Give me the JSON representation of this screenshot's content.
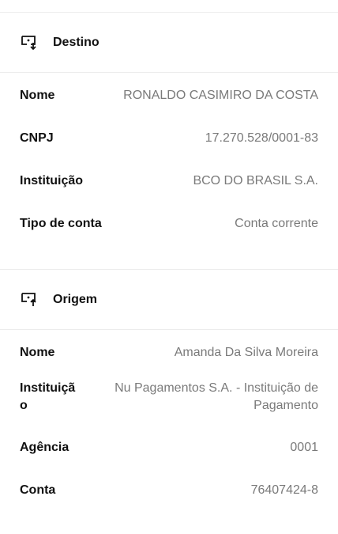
{
  "destino": {
    "title": "Destino",
    "icon": "screen-download-icon",
    "rows": [
      {
        "label": "Nome",
        "value": "RONALDO CASIMIRO DA COSTA"
      },
      {
        "label": "CNPJ",
        "value": "17.270.528/0001-83"
      },
      {
        "label": "Instituição",
        "value": "BCO DO BRASIL S.A."
      },
      {
        "label": "Tipo de conta",
        "value": "Conta corrente"
      }
    ]
  },
  "origem": {
    "title": "Origem",
    "icon": "screen-upload-icon",
    "rows": [
      {
        "label": "Nome",
        "value": "Amanda Da Silva Moreira"
      },
      {
        "label": "Instituição",
        "value": "Nu Pagamentos S.A. - Instituição de Pagamento"
      },
      {
        "label": "Agência",
        "value": "0001"
      },
      {
        "label": "Conta",
        "value": "76407424-8"
      }
    ]
  }
}
